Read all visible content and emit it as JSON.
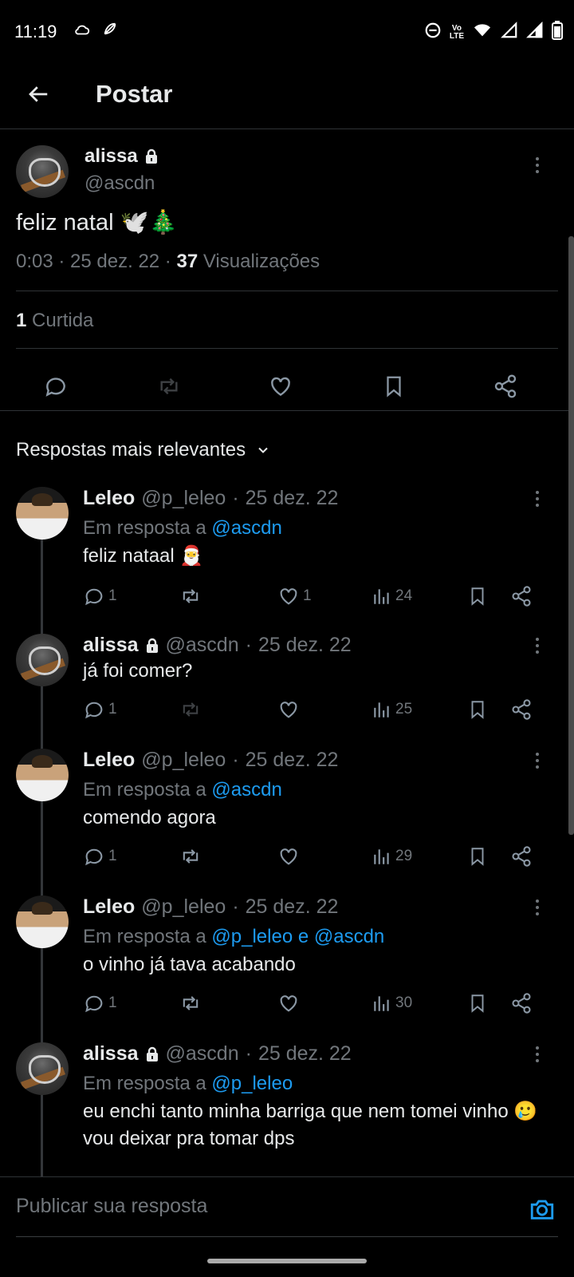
{
  "status": {
    "time": "11:19",
    "lte": "LTE"
  },
  "topbar": {
    "title": "Postar"
  },
  "post": {
    "name": "alissa",
    "handle": "@ascdn",
    "text": "feliz natal 🕊️🎄",
    "time": "0:03",
    "date": "25 dez. 22",
    "views_count": "37",
    "views_label": "Visualizações",
    "likes_count": "1",
    "likes_label": "Curtida"
  },
  "sort": {
    "label": "Respostas mais relevantes"
  },
  "replies": [
    {
      "name": "Leleo",
      "handle": "@p_leleo",
      "date": "25 dez. 22",
      "reply_prefix": "Em resposta a",
      "reply_to": "@ascdn",
      "text": "feliz nataal 🎅",
      "comments": "1",
      "likes": "1",
      "views": "24"
    },
    {
      "name": "alissa",
      "handle": "@ascdn",
      "date": "25 dez. 22",
      "text": "já foi comer?",
      "comments": "1",
      "likes": "",
      "views": "25"
    },
    {
      "name": "Leleo",
      "handle": "@p_leleo",
      "date": "25 dez. 22",
      "reply_prefix": "Em resposta a",
      "reply_to": "@ascdn",
      "text": "comendo agora",
      "comments": "1",
      "likes": "",
      "views": "29"
    },
    {
      "name": "Leleo",
      "handle": "@p_leleo",
      "date": "25 dez. 22",
      "reply_prefix": "Em resposta a",
      "reply_to": "@p_leleo e @ascdn",
      "text": "o vinho já tava acabando",
      "comments": "1",
      "likes": "",
      "views": "30"
    },
    {
      "name": "alissa",
      "handle": "@ascdn",
      "date": "25 dez. 22",
      "reply_prefix": "Em resposta a",
      "reply_to": "@p_leleo",
      "text": "eu enchi tanto minha barriga que nem tomei vinho 🥲 vou deixar pra tomar dps"
    }
  ],
  "compose": {
    "placeholder": "Publicar sua resposta"
  },
  "colors": {
    "accent": "#1d9bf0",
    "muted": "#71767b",
    "text": "#e7e9ea",
    "background": "#000000"
  }
}
